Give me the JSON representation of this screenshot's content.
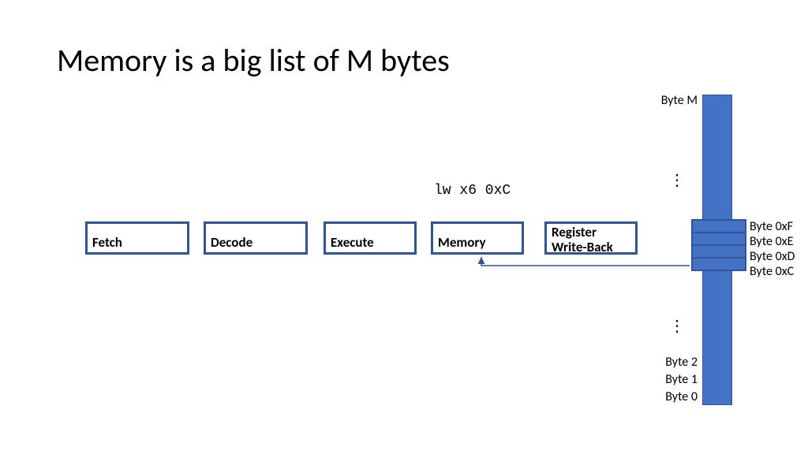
{
  "title": "Memory is a big list of M bytes",
  "instruction": "lw x6 0xC",
  "stages": {
    "fetch": "Fetch",
    "decode": "Decode",
    "execute": "Execute",
    "memory": "Memory",
    "writeback": "Register Write-Back"
  },
  "memory_labels": {
    "top": "Byte M",
    "cells": [
      "Byte  0xF",
      "Byte  0xE",
      "Byte  0xD",
      "Byte  0xC"
    ],
    "bottom": [
      "Byte 2",
      "Byte 1",
      "Byte 0"
    ]
  },
  "ellipsis": "⋮"
}
